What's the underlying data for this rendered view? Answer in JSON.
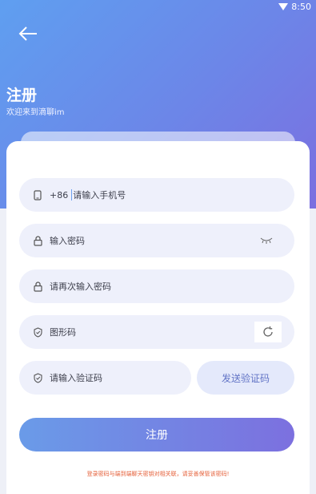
{
  "status_bar": {
    "time": "8:50"
  },
  "header": {
    "title": "注册",
    "subtitle": "欢迎来到滴聊im"
  },
  "form": {
    "phone": {
      "prefix": "+86",
      "placeholder": "请输入手机号"
    },
    "password": {
      "placeholder": "输入密码"
    },
    "confirm_password": {
      "placeholder": "请再次输入密码"
    },
    "captcha": {
      "placeholder": "图形码"
    },
    "sms_code": {
      "placeholder": "请输入验证码"
    },
    "send_code_label": "发送验证码",
    "submit_label": "注册",
    "notice": "登录密码与端到端聊天密钥对相关联，请妥善保管该密码!"
  },
  "colors": {
    "accent": "#6c86e8",
    "notice": "#e5603a",
    "field_bg": "#eef0fb"
  },
  "icons": [
    "back-arrow-icon",
    "wifi-icon",
    "phone-icon",
    "lock-icon",
    "eye-closed-icon",
    "shield-icon",
    "refresh-icon"
  ]
}
